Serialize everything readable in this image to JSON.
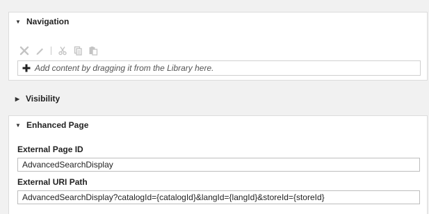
{
  "navigation": {
    "title": "Navigation",
    "dropzone_text": "Add content by dragging it from the Library here.",
    "toolbar_icons": [
      "close-icon",
      "edit-icon",
      "cut-icon",
      "copy-icon",
      "paste-icon"
    ]
  },
  "visibility": {
    "title": "Visibility"
  },
  "enhanced_page": {
    "title": "Enhanced Page",
    "external_page_id_label": "External Page ID",
    "external_page_id_value": "AdvancedSearchDisplay",
    "external_uri_label": "External URI Path",
    "external_uri_value": "AdvancedSearchDisplay?catalogId={catalogId}&langId={langId}&storeId={storeId}"
  },
  "colors": {
    "background": "#f1f1f1",
    "panel": "#ffffff",
    "disabled_icon": "#c4c4c4"
  }
}
